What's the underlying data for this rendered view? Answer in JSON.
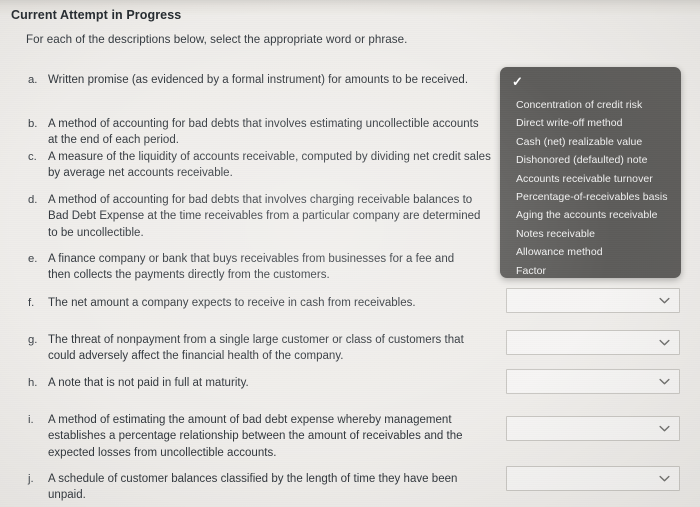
{
  "header": {
    "title": "Current Attempt in Progress",
    "instruction": "For each of the descriptions below, select the appropriate word or phrase."
  },
  "questions": [
    {
      "marker": "a.",
      "text": "Written promise (as evidenced by a formal instrument) for amounts to be received."
    },
    {
      "marker": "b.",
      "text": "A method of accounting for bad debts that involves estimating uncollectible accounts at the end of each period."
    },
    {
      "marker": "c.",
      "text": "A measure of the liquidity of accounts receivable, computed by dividing net credit sales by average net accounts receivable."
    },
    {
      "marker": "d.",
      "text": "A method of accounting for bad debts that involves charging receivable balances to Bad Debt Expense at the time receivables from a particular company are determined to be uncollectible."
    },
    {
      "marker": "e.",
      "text": "A finance company or bank that buys receivables from businesses for a fee and then collects the payments directly from the customers."
    },
    {
      "marker": "f.",
      "text": "The net amount a company expects to receive in cash from receivables."
    },
    {
      "marker": "g.",
      "text": "The threat of nonpayment from a single large customer or class of customers that could adversely affect the financial health of the company."
    },
    {
      "marker": "h.",
      "text": "A note that is not paid in full at maturity."
    },
    {
      "marker": "i.",
      "text": "A method of estimating the amount of bad debt expense whereby management establishes a percentage relationship between the amount of receivables and the expected losses from uncollectible accounts."
    },
    {
      "marker": "j.",
      "text": "A schedule of customer balances classified by the length of time they have been unpaid."
    }
  ],
  "selects": [
    {
      "id": "select-f",
      "value": "",
      "icon": "chevron-down-icon"
    },
    {
      "id": "select-g",
      "value": "",
      "icon": "chevron-down-icon"
    },
    {
      "id": "select-h",
      "value": "",
      "icon": "chevron-down-icon"
    },
    {
      "id": "select-i",
      "value": "",
      "icon": "chevron-down-icon"
    },
    {
      "id": "select-j",
      "value": "",
      "icon": "chevron-down-icon"
    }
  ],
  "dropdown": {
    "open": true,
    "check_glyph": "✓",
    "selected_value": "",
    "background_color": "#5d5c5a",
    "text_color": "#f2f2f2",
    "options": [
      "Concentration of credit risk",
      "Direct write-off method",
      "Cash (net) realizable value",
      "Dishonored (defaulted) note",
      "Accounts receivable turnover",
      "Percentage-of-receivables basis",
      "Aging the accounts receivable",
      "Notes receivable",
      "Allowance method",
      "Factor"
    ]
  }
}
